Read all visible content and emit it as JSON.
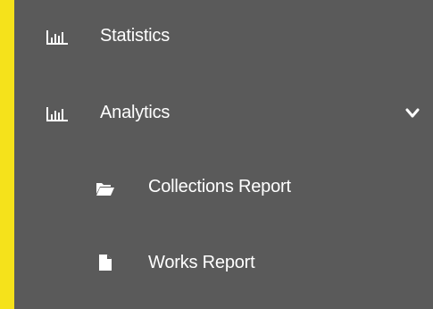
{
  "sidebar": {
    "background": "#5a5a5a",
    "page_background": "#f5e21b",
    "items": [
      {
        "label": "Statistics",
        "icon": "bar-chart-icon"
      },
      {
        "label": "Analytics",
        "icon": "bar-chart-icon",
        "expanded": true,
        "chevron": "chevron-down-icon"
      },
      {
        "label": "Collections Report",
        "icon": "folder-open-icon"
      },
      {
        "label": "Works Report",
        "icon": "file-icon"
      }
    ]
  }
}
